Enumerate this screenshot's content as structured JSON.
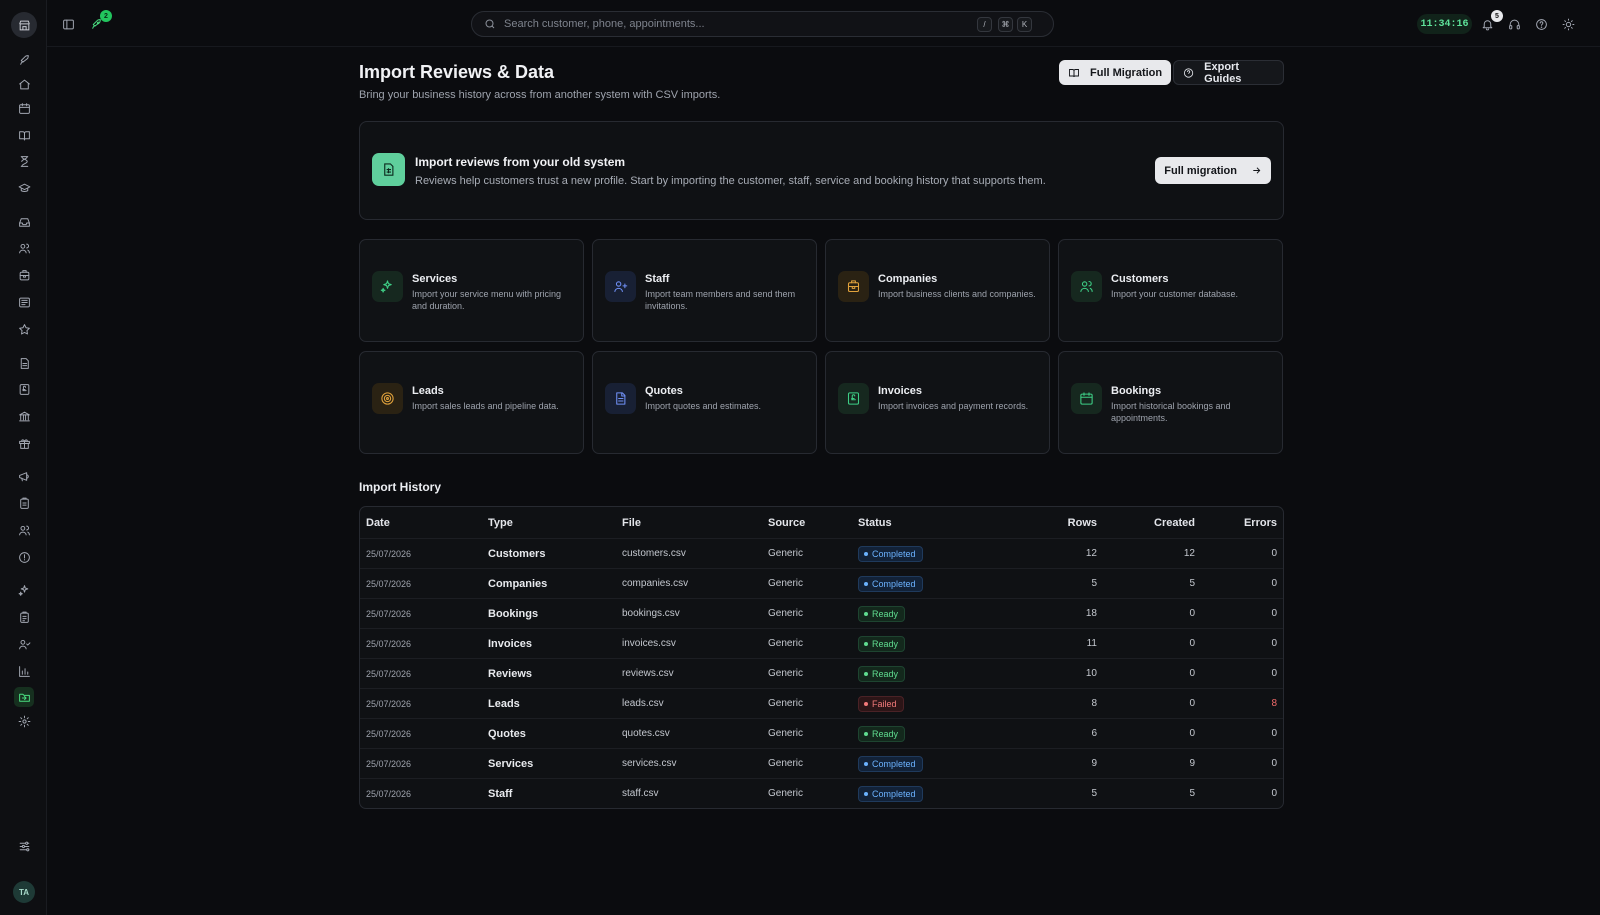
{
  "topbar": {
    "search_placeholder": "Search customer, phone, appointments...",
    "kbd_keys": [
      "/",
      "⌘",
      "K"
    ],
    "rocket_badge": "2",
    "clock": "11:34:16",
    "notifications_badge": "5"
  },
  "user": {
    "initials": "TA"
  },
  "header": {
    "title": "Import Reviews & Data",
    "subtitle": "Bring your business history across from another system with CSV imports.",
    "full_migration_label": "Full Migration",
    "export_guides_label": "Export Guides"
  },
  "banner": {
    "title": "Import reviews from your old system",
    "description": "Reviews help customers trust a new profile. Start by importing the customer, staff, service and booking history that supports them.",
    "button_label": "Full migration"
  },
  "cards": [
    {
      "title": "Services",
      "description": "Import your service menu with pricing and duration.",
      "icon": "sparkles-icon",
      "color": "green"
    },
    {
      "title": "Staff",
      "description": "Import team members and send them invitations.",
      "icon": "user-plus-icon",
      "color": "blue"
    },
    {
      "title": "Companies",
      "description": "Import business clients and companies.",
      "icon": "building-icon",
      "color": "amber"
    },
    {
      "title": "Customers",
      "description": "Import your customer database.",
      "icon": "users-icon",
      "color": "green"
    },
    {
      "title": "Leads",
      "description": "Import sales leads and pipeline data.",
      "icon": "target-icon",
      "color": "amber"
    },
    {
      "title": "Quotes",
      "description": "Import quotes and estimates.",
      "icon": "file-text-icon",
      "color": "blue"
    },
    {
      "title": "Invoices",
      "description": "Import invoices and payment records.",
      "icon": "receipt-pound-icon",
      "color": "green"
    },
    {
      "title": "Bookings",
      "description": "Import historical bookings and appointments.",
      "icon": "calendar-icon",
      "color": "green"
    }
  ],
  "history": {
    "title": "Import History",
    "columns": [
      "Date",
      "Type",
      "File",
      "Source",
      "Status",
      "Rows",
      "Created",
      "Errors"
    ],
    "rows": [
      {
        "date": "25/07/2026",
        "type": "Customers",
        "file": "customers.csv",
        "source": "Generic",
        "status": "Completed",
        "rows": "12",
        "created": "12",
        "errors": "0"
      },
      {
        "date": "25/07/2026",
        "type": "Companies",
        "file": "companies.csv",
        "source": "Generic",
        "status": "Completed",
        "rows": "5",
        "created": "5",
        "errors": "0"
      },
      {
        "date": "25/07/2026",
        "type": "Bookings",
        "file": "bookings.csv",
        "source": "Generic",
        "status": "Ready",
        "rows": "18",
        "created": "0",
        "errors": "0"
      },
      {
        "date": "25/07/2026",
        "type": "Invoices",
        "file": "invoices.csv",
        "source": "Generic",
        "status": "Ready",
        "rows": "11",
        "created": "0",
        "errors": "0"
      },
      {
        "date": "25/07/2026",
        "type": "Reviews",
        "file": "reviews.csv",
        "source": "Generic",
        "status": "Ready",
        "rows": "10",
        "created": "0",
        "errors": "0"
      },
      {
        "date": "25/07/2026",
        "type": "Leads",
        "file": "leads.csv",
        "source": "Generic",
        "status": "Failed",
        "rows": "8",
        "created": "0",
        "errors": "8"
      },
      {
        "date": "25/07/2026",
        "type": "Quotes",
        "file": "quotes.csv",
        "source": "Generic",
        "status": "Ready",
        "rows": "6",
        "created": "0",
        "errors": "0"
      },
      {
        "date": "25/07/2026",
        "type": "Services",
        "file": "services.csv",
        "source": "Generic",
        "status": "Completed",
        "rows": "9",
        "created": "9",
        "errors": "0"
      },
      {
        "date": "25/07/2026",
        "type": "Staff",
        "file": "staff.csv",
        "source": "Generic",
        "status": "Completed",
        "rows": "5",
        "created": "5",
        "errors": "0"
      }
    ]
  },
  "sidebar_icons": [
    "rocket-icon",
    "home-icon",
    "calendar-icon",
    "book-icon",
    "hourglass-icon",
    "graduation-cap-icon",
    "inbox-icon",
    "users-icon",
    "building-icon",
    "newspaper-icon",
    "star-icon",
    "file-icon",
    "receipt-pound-icon",
    "landmark-icon",
    "gift-icon",
    "megaphone-icon",
    "clipboard-icon",
    "users-icon",
    "alert-circle-icon",
    "sparkles-icon",
    "clipboard-list-icon",
    "user-check-icon",
    "bar-chart-icon",
    "folder-import-icon",
    "settings-icon",
    "sliders-icon"
  ],
  "colors": {
    "accent": "#4ade80",
    "completed": "#6bb2ff",
    "ready": "#5fdc8f",
    "failed": "#f27a7a"
  }
}
